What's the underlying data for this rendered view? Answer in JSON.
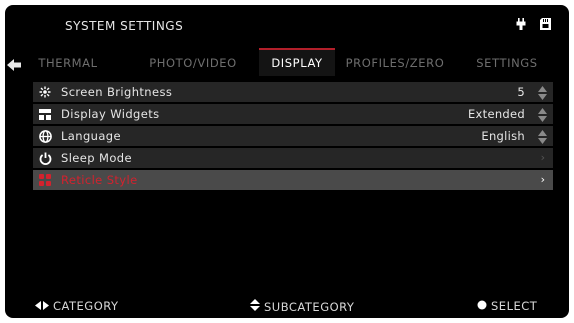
{
  "header": {
    "title": "SYSTEM SETTINGS",
    "status_icons": [
      "battery-power-icon",
      "sd-card-icon"
    ]
  },
  "nav": {
    "back_icon": "back-arrow-icon"
  },
  "tabs": [
    {
      "label": "THERMAL",
      "active": false
    },
    {
      "label": "PHOTO/VIDEO",
      "active": false
    },
    {
      "label": "DISPLAY",
      "active": true
    },
    {
      "label": "PROFILES/ZERO",
      "active": false
    },
    {
      "label": "SETTINGS",
      "active": false
    }
  ],
  "menu": [
    {
      "icon": "brightness-icon",
      "label": "Screen Brightness",
      "value": "5",
      "control": "up-down"
    },
    {
      "icon": "widgets-icon",
      "label": "Display Widgets",
      "value": "Extended",
      "control": "up-down"
    },
    {
      "icon": "globe-icon",
      "label": "Language",
      "value": "English",
      "control": "up-down"
    },
    {
      "icon": "power-icon",
      "label": "Sleep Mode",
      "value": "",
      "control": "chevron"
    },
    {
      "icon": "reticle-icon",
      "label": "Reticle Style",
      "value": "",
      "control": "chevron",
      "selected": true
    }
  ],
  "footer": {
    "category": "CATEGORY",
    "subcategory": "SUBCATEGORY",
    "select": "SELECT"
  },
  "colors": {
    "accent": "#d3222e",
    "background": "#000000",
    "row": "#262626",
    "row_selected": "#4a4a4a"
  }
}
